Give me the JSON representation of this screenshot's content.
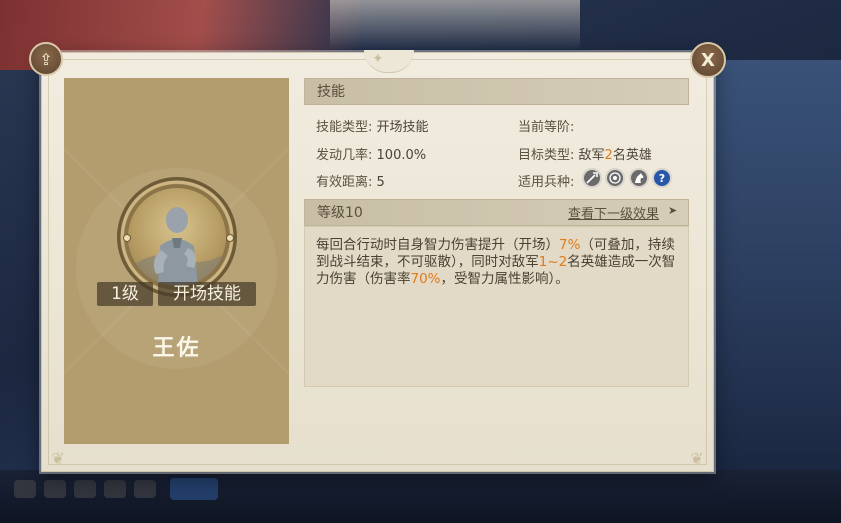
{
  "hero": {
    "name": "王佐",
    "skill_level_tag": "1级",
    "skill_type_tag": "开场技能"
  },
  "skill_section": {
    "header": "技能",
    "skill_type_label": "技能类型:",
    "skill_type_value": "开场技能",
    "current_grade_label": "当前等阶:",
    "current_grade_value": "",
    "trigger_rate_label": "发动几率:",
    "trigger_rate_value": "100.0%",
    "target_type_label": "目标类型:",
    "target_prefix": "敌军",
    "target_count": "2",
    "target_suffix": "名英雄",
    "range_label": "有效距离:",
    "range_value": "5",
    "troop_label": "适用兵种:",
    "troop_icons": [
      "sword",
      "bow",
      "horse",
      "question"
    ]
  },
  "level_section": {
    "level_text": "等级10",
    "next_level_link": "查看下一级效果",
    "next_arrow": "➤"
  },
  "description": {
    "p1": "每回合行动时自身智力伤害提升（开场）",
    "v1": "7%",
    "p2": "（可叠加，持续到战斗结束，不可驱散），同时对敌军",
    "v2": "1~2",
    "p3": "名英雄造成一次智力伤害（伤害率",
    "v3": "70%",
    "p4": "，受智力属性影响）。"
  },
  "buttons": {
    "share_icon": "⇪",
    "close_label": "X"
  },
  "colors": {
    "highlight": "#e07b1a",
    "portrait_bg": "#b39c6d",
    "panel_bg": "#ebe5d5"
  }
}
